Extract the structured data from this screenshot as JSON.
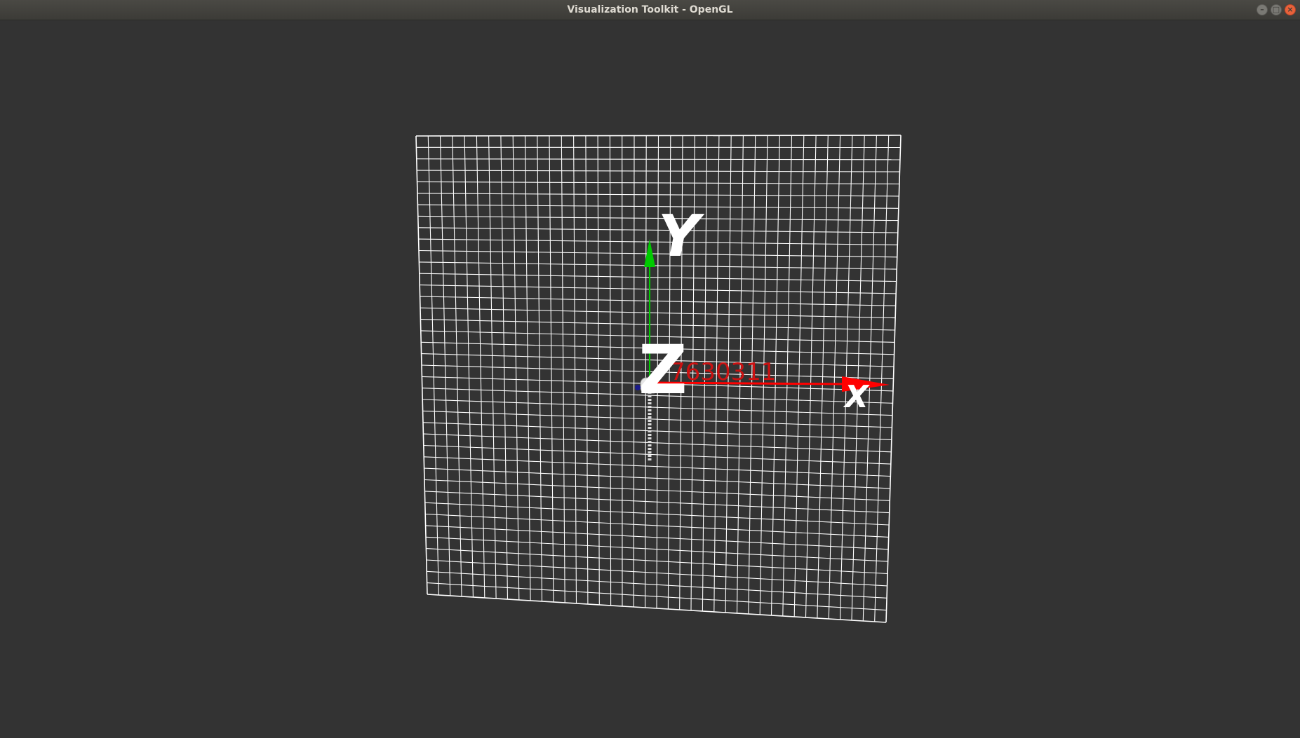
{
  "window": {
    "title": "Visualization Toolkit - OpenGL",
    "buttons": {
      "minimize": "–",
      "maximize": "□",
      "close": "×"
    }
  },
  "scene": {
    "background_color": "#333333",
    "grid_color": "#ffffff",
    "axes": {
      "x": {
        "label": "X",
        "color": "#ff0000"
      },
      "y": {
        "label": "Y",
        "color": "#00cc00"
      },
      "z": {
        "label": "Z",
        "color": "#ffffff"
      }
    },
    "overlay_text": "7630311",
    "overlay_text_color": "#cc1111"
  }
}
